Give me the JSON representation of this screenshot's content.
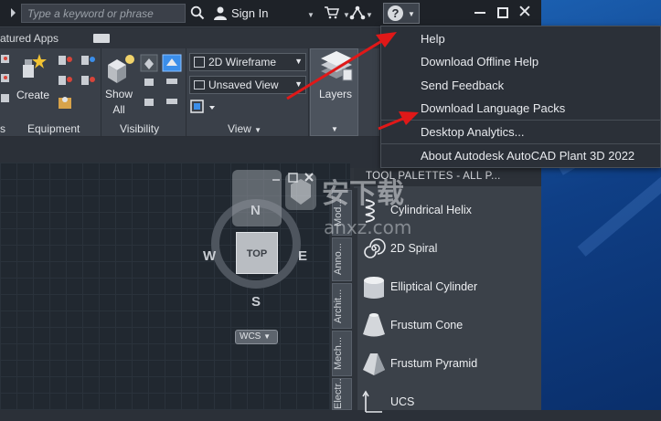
{
  "titlebar": {
    "search_placeholder": "Type a keyword or phrase",
    "sign_in": "Sign In"
  },
  "ribbon": {
    "tab_featured": "atured Apps",
    "create_label": "Create",
    "show_all_line1": "Show",
    "show_all_line2": "All",
    "visual_style": "2D Wireframe",
    "view_name": "Unsaved View",
    "layers_label": "Layers",
    "panel_s": "s",
    "panel_equipment": "Equipment",
    "panel_visibility": "Visibility",
    "panel_view": "View"
  },
  "viewcube": {
    "north": "N",
    "south": "S",
    "east": "E",
    "west": "W",
    "top_face": "TOP",
    "wcs": "WCS"
  },
  "tool_palettes": {
    "title": "TOOL PALETTES - ALL P...",
    "tabs": [
      "Mod...",
      "Anno...",
      "Archit...",
      "Mech...",
      "Electr..."
    ],
    "items": [
      {
        "label": "Cylindrical Helix"
      },
      {
        "label": "2D Spiral"
      },
      {
        "label": "Elliptical Cylinder"
      },
      {
        "label": "Frustum Cone"
      },
      {
        "label": "Frustum Pyramid"
      },
      {
        "label": "UCS"
      }
    ]
  },
  "help_menu": {
    "items": [
      "Help",
      "Download Offline Help",
      "Send Feedback",
      "Download Language Packs",
      "Desktop Analytics...",
      "About Autodesk AutoCAD Plant 3D 2022"
    ]
  },
  "watermark": {
    "cn": "安下载",
    "en": "anxz.com"
  },
  "colors": {
    "arrow": "#e01818",
    "accent": "#3b8eea"
  }
}
